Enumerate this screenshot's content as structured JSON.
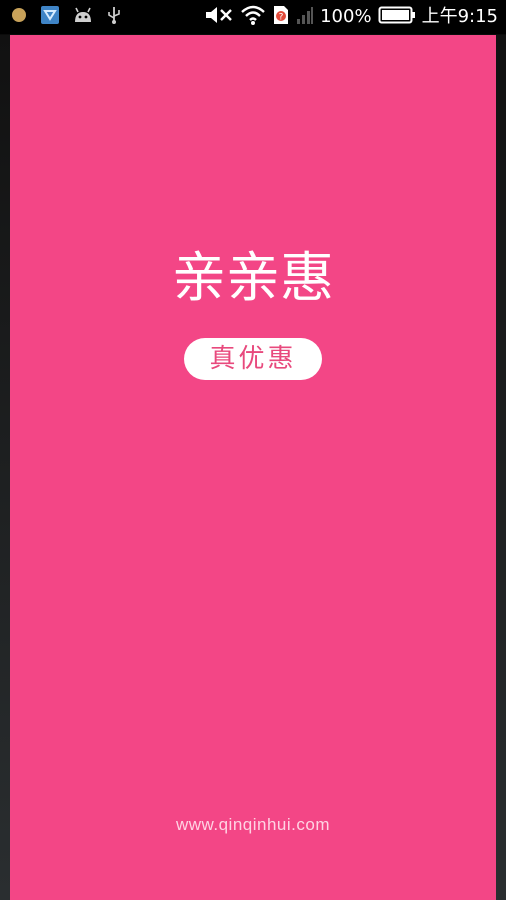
{
  "status_bar": {
    "battery_percent": "100%",
    "time": "上午9:15",
    "left_icons": [
      "notification-dot-icon",
      "app-notification-icon",
      "android-debug-icon",
      "usb-icon"
    ],
    "right_icons": [
      "mute-icon",
      "wifi-icon",
      "sim-unknown-icon",
      "signal-icon",
      "battery-icon"
    ],
    "battery_level": 1.0
  },
  "splash": {
    "app_name": "亲亲惠",
    "slogan": "真优惠",
    "website": "www.qinqinhui.com",
    "background_color": "#f34686",
    "slogan_text_color": "#e8497d"
  }
}
